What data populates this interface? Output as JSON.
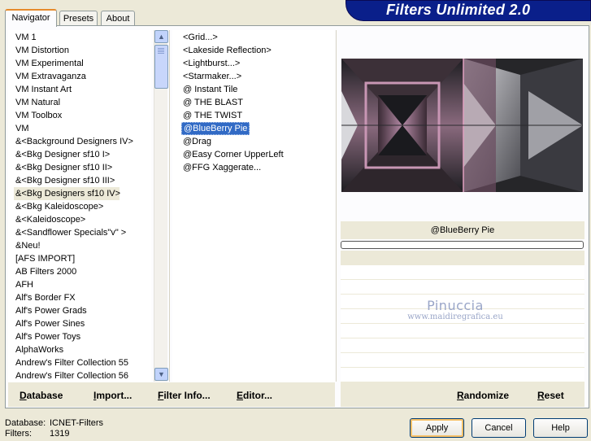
{
  "app": {
    "title": "Filters Unlimited 2.0"
  },
  "tabs": [
    {
      "label": "Navigator",
      "active": true
    },
    {
      "label": "Presets",
      "active": false
    },
    {
      "label": "About",
      "active": false
    }
  ],
  "categories": [
    "VM 1",
    "VM Distortion",
    "VM Experimental",
    "VM Extravaganza",
    "VM Instant Art",
    "VM Natural",
    "VM Toolbox",
    "VM",
    "&<Background Designers IV>",
    "&<Bkg Designer sf10 I>",
    "&<Bkg Designer sf10 II>",
    "&<Bkg Designer sf10 III>",
    "&<Bkg Designers sf10 IV>",
    "&<Bkg Kaleidoscope>",
    "&<Kaleidoscope>",
    "&<Sandflower Specials\"v\" >",
    "&Neu!",
    "[AFS IMPORT]",
    "AB Filters 2000",
    "AFH",
    "Alf's Border FX",
    "Alf's Power Grads",
    "Alf's Power Sines",
    "Alf's Power Toys",
    "AlphaWorks",
    "Andrew's Filter Collection 55",
    "Andrew's Filter Collection 56"
  ],
  "selected_category": "&<Bkg Designers sf10 IV>",
  "filters": [
    "<Grid...>",
    "<Lakeside Reflection>",
    "<Lightburst...>",
    "<Starmaker...>",
    "@ Instant Tile",
    "@ THE BLAST",
    "@ THE TWIST",
    "@BlueBerry Pie",
    "@Drag",
    "@Easy Corner UpperLeft",
    "@FFG Xaggerate..."
  ],
  "selected_filter": "@BlueBerry Pie",
  "preview": {
    "filter_name": "@BlueBerry Pie",
    "progress": 0
  },
  "watermark": {
    "name": "Pinuccia",
    "url": "www.maidiregrafica.eu"
  },
  "toolbar": {
    "database": "Database",
    "import": "Import...",
    "filter_info": "Filter Info...",
    "editor": "Editor...",
    "randomize": "Randomize",
    "reset": "Reset"
  },
  "status": {
    "database_label": "Database:",
    "database_value": "ICNET-Filters",
    "filters_label": "Filters:",
    "filters_value": "1319"
  },
  "buttons": {
    "apply": "Apply",
    "cancel": "Cancel",
    "help": "Help"
  },
  "colors": {
    "selection": "#316ac5",
    "banner": "#0a1f8a",
    "tab_accent": "#e68b2c"
  }
}
